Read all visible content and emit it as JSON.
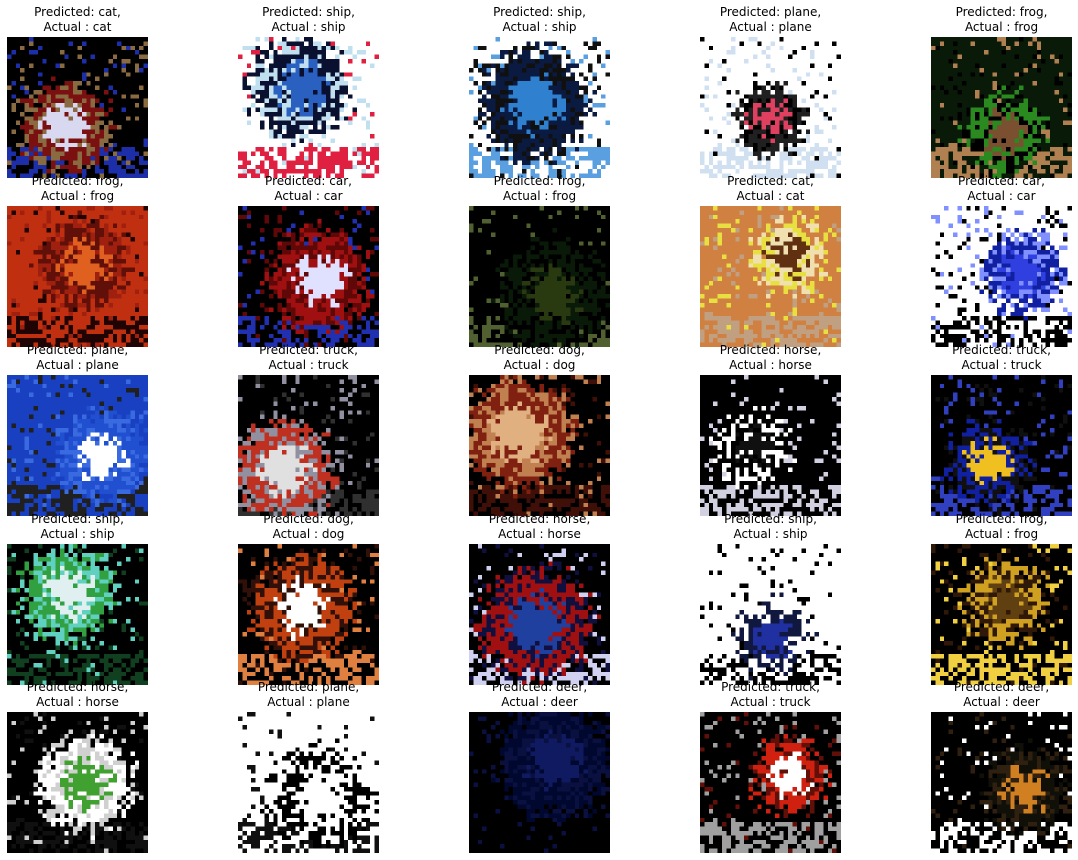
{
  "figure": {
    "panels": [
      {
        "predicted_label": "Predicted: cat,",
        "actual_label": "Actual : cat",
        "image": "cifar-cat-on-blue-blanket",
        "colors": [
          "#000000",
          "#7a1010",
          "#d8d8f0",
          "#1c2ea8",
          "#8a6a40"
        ]
      },
      {
        "predicted_label": "Predicted: ship,",
        "actual_label": "Actual : ship",
        "image": "cifar-white-boat",
        "colors": [
          "#ffffff",
          "#0a1030",
          "#2a60c0",
          "#e02040",
          "#c0e0f0"
        ]
      },
      {
        "predicted_label": "Predicted: ship,",
        "actual_label": "Actual : ship",
        "image": "cifar-blue-ship",
        "colors": [
          "#ffffff",
          "#0a1a40",
          "#3080d0",
          "#5aa0e0",
          "#101010"
        ]
      },
      {
        "predicted_label": "Predicted: plane,",
        "actual_label": "Actual : plane",
        "image": "cifar-jet-on-ground",
        "colors": [
          "#ffffff",
          "#202020",
          "#e04060",
          "#d0e0f0",
          "#000000"
        ]
      },
      {
        "predicted_label": "Predicted: frog,",
        "actual_label": "Actual : frog",
        "image": "cifar-frog-on-grass",
        "colors": [
          "#0a1a08",
          "#2a8a20",
          "#7a5030",
          "#b08050",
          "#000000"
        ]
      },
      {
        "predicted_label": "Predicted: frog,",
        "actual_label": "Actual : frog",
        "image": "cifar-red-frog",
        "colors": [
          "#c03010",
          "#601008",
          "#e06020",
          "#200404",
          "#a02010"
        ]
      },
      {
        "predicted_label": "Predicted: car,",
        "actual_label": "Actual : car",
        "image": "cifar-red-car",
        "colors": [
          "#000000",
          "#a01010",
          "#e0e0ff",
          "#2030b0",
          "#600808"
        ]
      },
      {
        "predicted_label": "Predicted: frog,",
        "actual_label": "Actual : frog",
        "image": "cifar-dark-frog",
        "colors": [
          "#000000",
          "#0a1a08",
          "#2a3a10",
          "#506030",
          "#000000"
        ]
      },
      {
        "predicted_label": "Predicted: cat,",
        "actual_label": "Actual : cat",
        "image": "cifar-tabby-cat",
        "colors": [
          "#d08040",
          "#f0e0b0",
          "#603010",
          "#c0a080",
          "#e8e040"
        ]
      },
      {
        "predicted_label": "Predicted: car,",
        "actual_label": "Actual : car",
        "image": "cifar-blue-truck-car",
        "colors": [
          "#ffffff",
          "#1020a0",
          "#3040e0",
          "#000000",
          "#8090ff"
        ]
      },
      {
        "predicted_label": "Predicted: plane,",
        "actual_label": "Actual : plane",
        "image": "cifar-plane-in-blue-sky",
        "colors": [
          "#1840c0",
          "#2050d0",
          "#ffffff",
          "#202020",
          "#3a6ae0"
        ]
      },
      {
        "predicted_label": "Predicted: truck,",
        "actual_label": "Actual : truck",
        "image": "cifar-red-white-truck",
        "colors": [
          "#000000",
          "#c03020",
          "#e0e0e0",
          "#303030",
          "#9090a0"
        ]
      },
      {
        "predicted_label": "Predicted: dog,",
        "actual_label": "Actual : dog",
        "image": "cifar-tan-dog",
        "colors": [
          "#000000",
          "#802010",
          "#e0b080",
          "#401008",
          "#c08050"
        ]
      },
      {
        "predicted_label": "Predicted: horse,",
        "actual_label": "Actual : horse",
        "image": "cifar-white-horse",
        "colors": [
          "#000000",
          "#ffffff",
          "#101010",
          "#d0d0e0",
          "#000000"
        ]
      },
      {
        "predicted_label": "Predicted: truck,",
        "actual_label": "Actual : truck",
        "image": "cifar-blue-dump-truck",
        "colors": [
          "#000000",
          "#1020a0",
          "#f0c020",
          "#3040c0",
          "#101010"
        ]
      },
      {
        "predicted_label": "Predicted: ship,",
        "actual_label": "Actual : ship",
        "image": "cifar-green-boat",
        "colors": [
          "#000000",
          "#30a040",
          "#e0f0f0",
          "#104020",
          "#60d0c0"
        ]
      },
      {
        "predicted_label": "Predicted: dog,",
        "actual_label": "Actual : dog",
        "image": "cifar-beagle",
        "colors": [
          "#000000",
          "#c04010",
          "#ffffff",
          "#e08040",
          "#301008"
        ]
      },
      {
        "predicted_label": "Predicted: horse,",
        "actual_label": "Actual : horse",
        "image": "cifar-dark-horse",
        "colors": [
          "#000000",
          "#a01010",
          "#2040a0",
          "#d0d0f0",
          "#101040"
        ]
      },
      {
        "predicted_label": "Predicted: ship,",
        "actual_label": "Actual : ship",
        "image": "cifar-dark-ship",
        "colors": [
          "#ffffff",
          "#101840",
          "#2030a0",
          "#000000",
          "#ffffff"
        ]
      },
      {
        "predicted_label": "Predicted: frog,",
        "actual_label": "Actual : frog",
        "image": "cifar-yellow-frog",
        "colors": [
          "#000000",
          "#d0a020",
          "#604010",
          "#f0d040",
          "#301808"
        ]
      },
      {
        "predicted_label": "Predicted: horse,",
        "actual_label": "Actual : horse",
        "image": "cifar-horse-on-grass",
        "colors": [
          "#000000",
          "#ffffff",
          "#40a030",
          "#101010",
          "#d0d0d0"
        ]
      },
      {
        "predicted_label": "Predicted: plane,",
        "actual_label": "Actual : plane",
        "image": "cifar-black-plane-on-white",
        "colors": [
          "#ffffff",
          "#000000",
          "#ffffff",
          "#101010",
          "#ffffff"
        ]
      },
      {
        "predicted_label": "Predicted: deer,",
        "actual_label": "Actual : deer",
        "image": "cifar-dark-deer",
        "colors": [
          "#000000",
          "#000830",
          "#101a60",
          "#000000",
          "#0a1040"
        ]
      },
      {
        "predicted_label": "Predicted: truck,",
        "actual_label": "Actual : truck",
        "image": "cifar-red-fire-truck",
        "colors": [
          "#000000",
          "#d02010",
          "#ffffff",
          "#a0a0a0",
          "#601008"
        ]
      },
      {
        "predicted_label": "Predicted: deer,",
        "actual_label": "Actual : deer",
        "image": "cifar-deer-dark-field",
        "colors": [
          "#000000",
          "#101008",
          "#d08020",
          "#ffffff",
          "#302010"
        ]
      }
    ]
  }
}
